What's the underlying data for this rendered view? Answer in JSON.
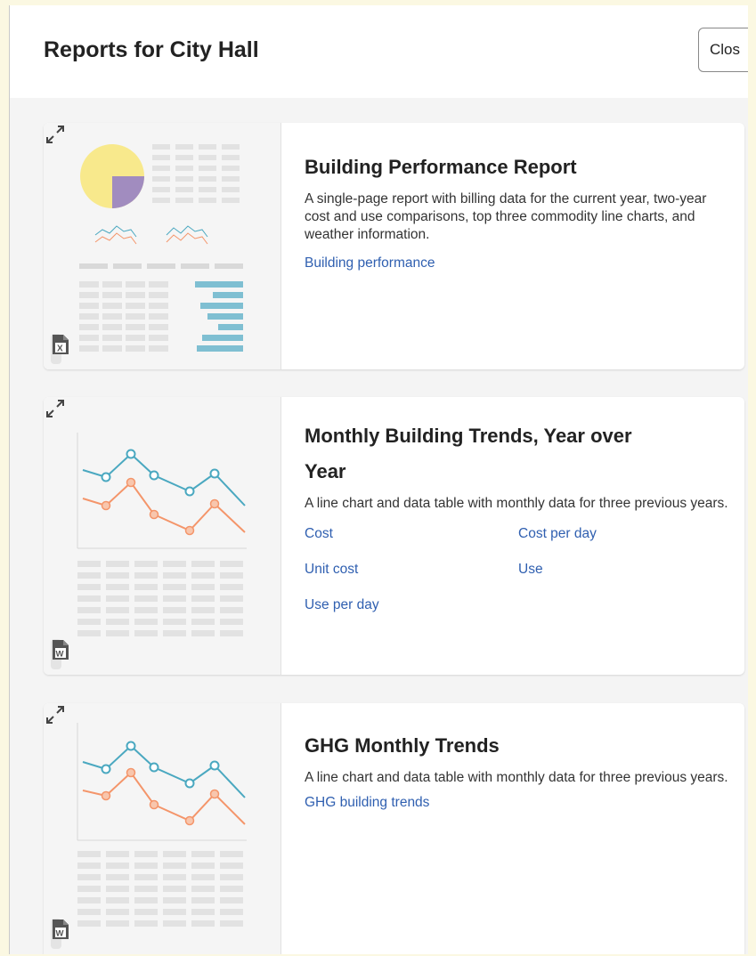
{
  "header": {
    "title": "Reports for City Hall",
    "close_label": "Clos"
  },
  "colors": {
    "link": "#2f5fb0",
    "teal": "#4aa8c0",
    "orange": "#f4956a",
    "pie_yellow": "#f8e98c",
    "pie_purple": "#a18cbf"
  },
  "cards": [
    {
      "title": "Building Performance Report",
      "description": "A single-page report with billing data for the current year, two-year cost and use comparisons, top three commodity line charts, and weather information.",
      "links": [
        "Building performance"
      ],
      "formats": [
        "pdf-icon",
        "excel-icon"
      ]
    },
    {
      "title_line1": "Monthly Building Trends, Year over",
      "title_line2": "Year",
      "description": "A line chart and data table with monthly data for three previous years.",
      "links": [
        "Cost",
        "Cost per day",
        "Unit cost",
        "Use",
        "Use per day"
      ],
      "formats": [
        "pdf-icon",
        "excel-icon",
        "word-icon"
      ]
    },
    {
      "title": "GHG Monthly Trends",
      "description": "A line chart and data table with monthly data for three previous years.",
      "links": [
        "GHG building trends"
      ],
      "formats": [
        "pdf-icon",
        "excel-icon",
        "word-icon"
      ]
    }
  ]
}
